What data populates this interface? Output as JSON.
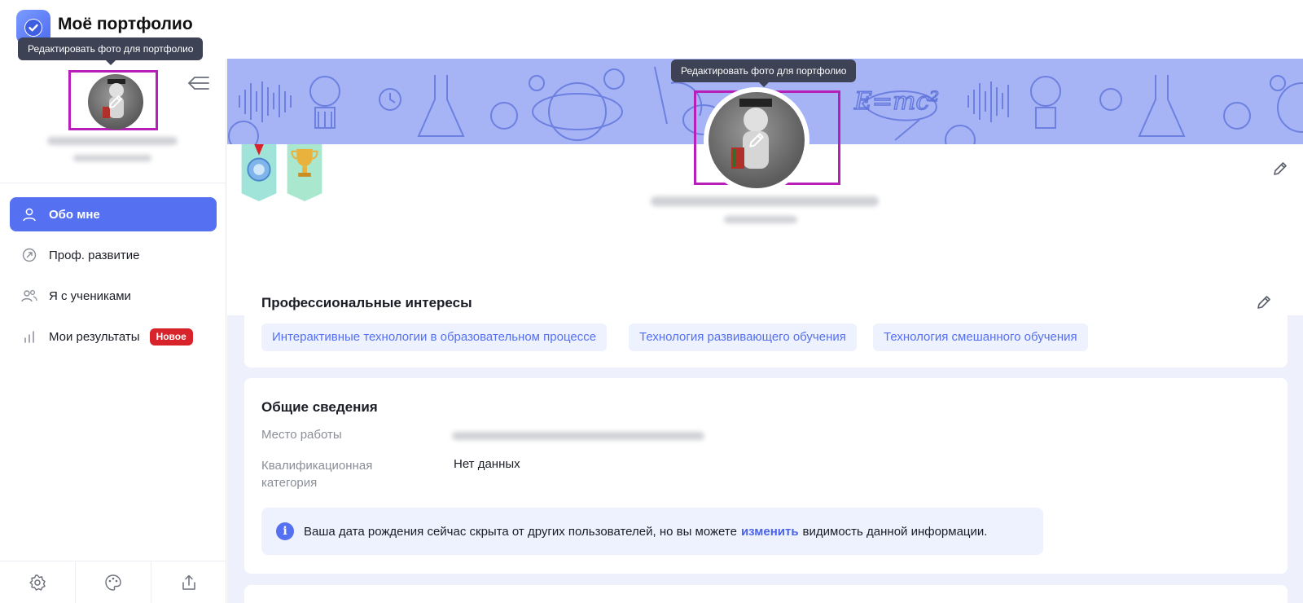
{
  "app": {
    "title": "Моё портфолио"
  },
  "tooltips": {
    "edit_photo": "Редактировать фото для портфолио"
  },
  "sidebar": {
    "items": [
      {
        "label": "Обо мне",
        "icon": "user-icon",
        "active": true
      },
      {
        "label": "Проф. развитие",
        "icon": "growth-arrow-icon"
      },
      {
        "label": "Я с учениками",
        "icon": "users-icon"
      },
      {
        "label": "Мои результаты",
        "icon": "bar-chart-icon",
        "badge": "Новое"
      }
    ],
    "bottom_icons": [
      "settings-gear-icon",
      "palette-icon",
      "share-icon"
    ]
  },
  "profile": {
    "badges": [
      "medal-icon",
      "trophy-icon"
    ]
  },
  "interests": {
    "title": "Профессиональные интересы",
    "chips": [
      "Интерактивные технологии в образовательном процессе",
      "Технология развивающего обучения",
      "Технология смешанного обучения"
    ]
  },
  "general": {
    "title": "Общие сведения",
    "work_label": "Место работы",
    "qualification_label_1": "Квалификационная",
    "qualification_label_2": "категория",
    "qualification_value": "Нет данных",
    "info_text_before": "Ваша дата рождения сейчас скрыта от других пользователей, но вы можете",
    "info_link": "изменить",
    "info_text_after": "видимость данной информации."
  },
  "colors": {
    "accent": "#5570f1",
    "banner": "#a6b4f6",
    "highlight_box": "#b81fb8",
    "badge_red": "#d8232a"
  }
}
